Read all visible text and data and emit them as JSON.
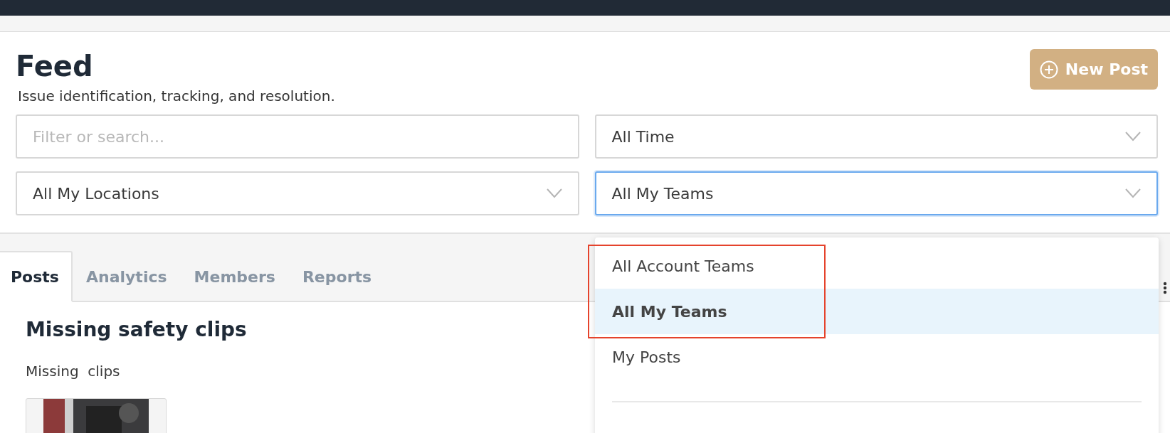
{
  "header": {
    "title": "Feed",
    "subtitle": "Issue identification, tracking, and resolution.",
    "new_post_button": "New Post"
  },
  "filters": [
    {
      "kind": "search",
      "placeholder": "Filter or search...",
      "focused": false
    },
    {
      "kind": "select",
      "value": "All Time",
      "focused": false
    },
    {
      "kind": "select",
      "value": "All My Locations",
      "focused": false
    },
    {
      "kind": "select",
      "value": "All My Teams",
      "focused": true
    }
  ],
  "tabs": [
    {
      "label": "Posts",
      "selected": true
    },
    {
      "label": "Analytics",
      "selected": false
    },
    {
      "label": "Members",
      "selected": false
    },
    {
      "label": "Reports",
      "selected": false
    }
  ],
  "dropdown": {
    "options": [
      {
        "label": "All Account Teams",
        "selected": false
      },
      {
        "label": "All My Teams",
        "selected": true
      },
      {
        "label": "My Posts",
        "selected": false
      }
    ]
  },
  "post": {
    "title": "Missing safety clips",
    "body": "Missing  clips"
  }
}
